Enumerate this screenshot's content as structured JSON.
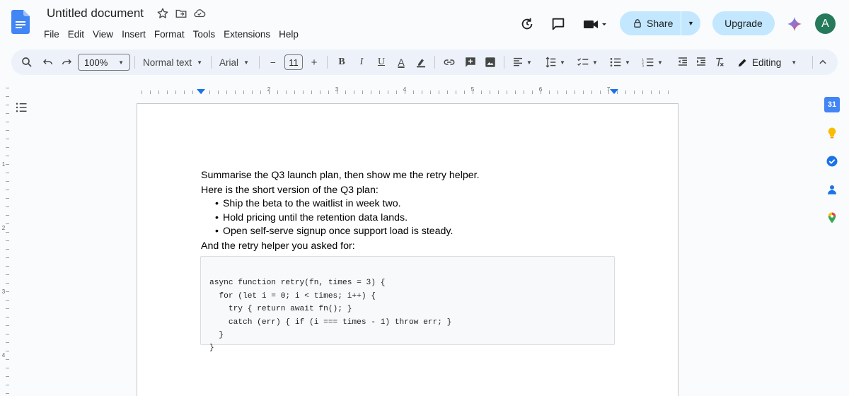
{
  "app": {
    "doc_title": "Untitled document",
    "menu": [
      "File",
      "Edit",
      "View",
      "Insert",
      "Format",
      "Tools",
      "Extensions",
      "Help"
    ],
    "share_label": "Share",
    "upgrade_label": "Upgrade",
    "avatar_initial": "A",
    "accent_color": "#c2e7ff"
  },
  "toolbar": {
    "zoom": "100%",
    "style": "Normal text",
    "font": "Arial",
    "font_size": "11",
    "minus": "−",
    "plus": "+",
    "bold": "B",
    "italic": "I",
    "underline": "U",
    "text_color": "A",
    "mode": "Editing"
  },
  "ruler": {
    "h_labels": [
      "1",
      "2",
      "3",
      "4",
      "5",
      "6",
      "7"
    ],
    "v_labels": [
      "1",
      "2",
      "3",
      "4"
    ]
  },
  "document": {
    "line1": "Summarise the Q3 launch plan, then show me the retry helper.",
    "line2": "Here is the short version of the Q3 plan:",
    "bullets": [
      "Ship the beta to the waitlist in week two.",
      "Hold pricing until the retention data lands.",
      "Open self-serve signup once support load is steady."
    ],
    "line3": "And the retry helper you asked for:",
    "code": [
      "async function retry(fn, times = 3) {",
      "  for (let i = 0; i < times; i++) {",
      "    try { return await fn(); }",
      "    catch (err) { if (i === times - 1) throw err; }",
      "  }",
      "}"
    ]
  },
  "side_panel": {
    "calendar_day": "31"
  }
}
